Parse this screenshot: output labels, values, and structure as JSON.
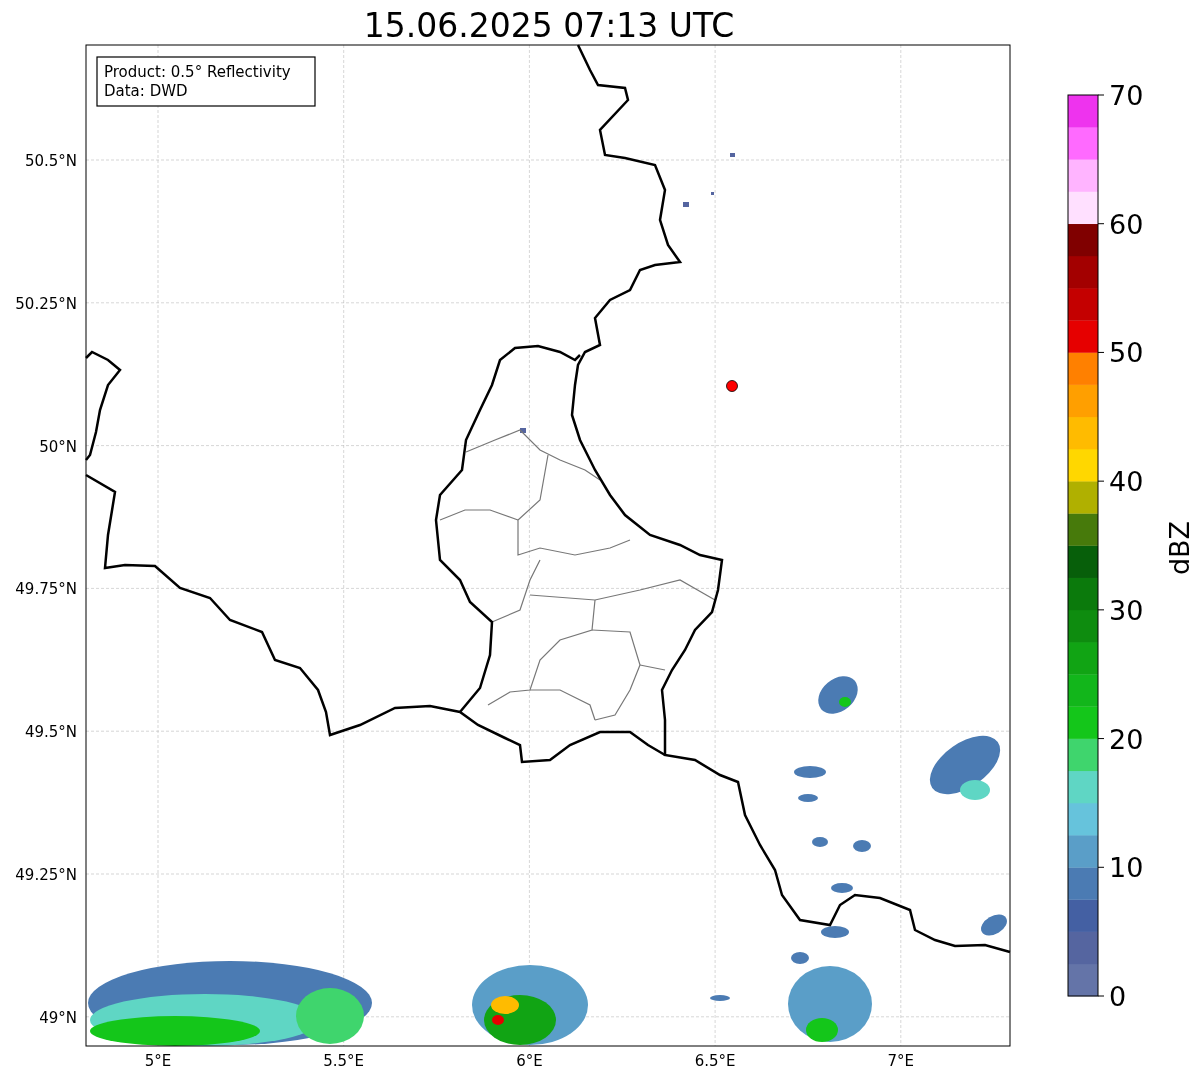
{
  "title": "15.06.2025 07:13 UTC",
  "info_box": {
    "lines": [
      "Product: 0.5° Reflectivity",
      "Data: DWD"
    ]
  },
  "lat_ticks": [
    "50.5°N",
    "50.25°N",
    "50°N",
    "49.75°N",
    "49.5°N",
    "49.25°N",
    "49°N"
  ],
  "lon_ticks": [
    "5°E",
    "5.5°E",
    "6°E",
    "6.5°E",
    "7°E"
  ],
  "colorbar": {
    "label": "dBZ",
    "ticks": [
      "70",
      "60",
      "50",
      "40",
      "30",
      "20",
      "10",
      "0"
    ],
    "bands": [
      {
        "color": "#6474a8"
      },
      {
        "color": "#5565a0"
      },
      {
        "color": "#4460a3"
      },
      {
        "color": "#4b7bb3"
      },
      {
        "color": "#5a9ec8"
      },
      {
        "color": "#66c3dc"
      },
      {
        "color": "#5fd6c4"
      },
      {
        "color": "#3fd56d"
      },
      {
        "color": "#14c61a"
      },
      {
        "color": "#12b61b"
      },
      {
        "color": "#11a414"
      },
      {
        "color": "#0e8c0f"
      },
      {
        "color": "#0b7a0c"
      },
      {
        "color": "#075f0a"
      },
      {
        "color": "#477a0b"
      },
      {
        "color": "#b0b000"
      },
      {
        "color": "#ffd700"
      },
      {
        "color": "#ffbb00"
      },
      {
        "color": "#ff9f00"
      },
      {
        "color": "#ff8000"
      },
      {
        "color": "#e60000"
      },
      {
        "color": "#c40000"
      },
      {
        "color": "#a30000"
      },
      {
        "color": "#800000"
      },
      {
        "color": "#ffe0ff"
      },
      {
        "color": "#ffb4ff"
      },
      {
        "color": "#ff6aff"
      },
      {
        "color": "#ee33ee"
      }
    ]
  }
}
